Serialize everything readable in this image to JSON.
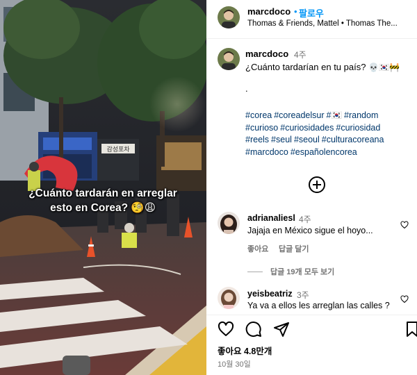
{
  "media": {
    "overlay_text": "¿Cuánto tardarán en arreglar\nesto en Corea? 🧐😩",
    "sign_text": "감성포차"
  },
  "header": {
    "username": "marcdoco",
    "separator": "•",
    "follow_label": "팔로우",
    "subtitle": "Thomas & Friends, Mattel • Thomas The..."
  },
  "caption": {
    "username": "marcdoco",
    "time": "4주",
    "text": "¿Cuánto tardarían en tu país?",
    "emojis": "💀🇰🇷🚧",
    "dot": ".",
    "hashtags": [
      "#corea",
      "#coreadelsur",
      "#🇰🇷",
      "#random",
      "#curioso",
      "#curiosidades",
      "#curiosidad",
      "#reels",
      "#seul",
      "#seoul",
      "#culturacoreana",
      "#marcdoco",
      "#españolencorea"
    ]
  },
  "load_more_icon": "plus-circle-icon",
  "comments": [
    {
      "username": "adrianaliesl",
      "time": "4주",
      "text": "Jajaja en México sigue el hoyo...",
      "like_label": "좋아요",
      "reply_label": "답글 달기",
      "view_replies": "답글 19개 모두 보기"
    },
    {
      "username": "yeisbeatriz",
      "time": "3주",
      "text": "Ya va a ellos les arreglan las calles ?"
    }
  ],
  "actions": {
    "icons": [
      "heart-icon",
      "comment-icon",
      "share-icon",
      "bookmark-icon"
    ],
    "likes": "좋아요 4.8만개",
    "date": "10월 30일"
  },
  "colors": {
    "link_blue": "#0095f6",
    "hashtag_blue": "#00376b",
    "muted_gray": "#737373"
  }
}
